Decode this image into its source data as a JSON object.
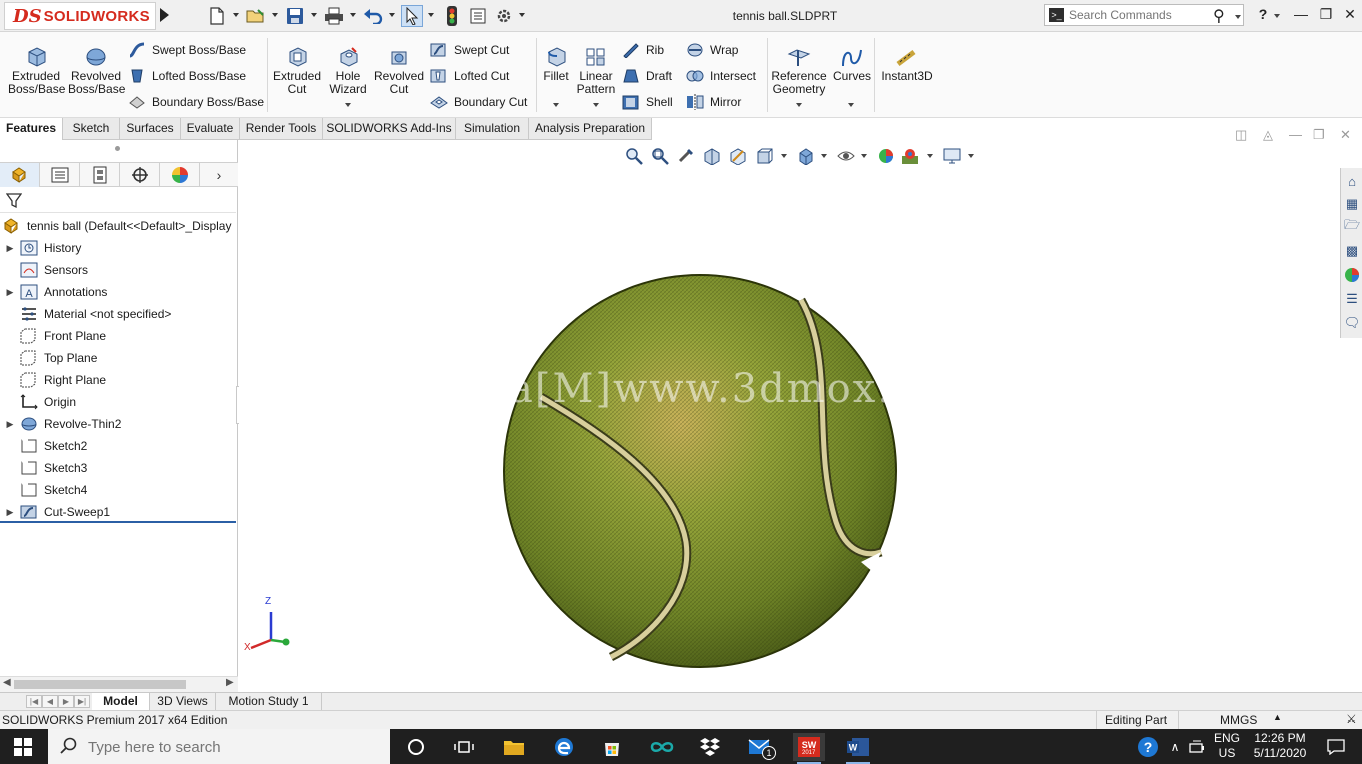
{
  "app": {
    "logo_ds": "DS",
    "logo_text": "SOLIDWORKS",
    "document_title": "tennis ball.SLDPRT",
    "search_placeholder": "Search Commands",
    "help_label": "?"
  },
  "ribbon": {
    "features_large": [
      {
        "label_1": "Extruded",
        "label_2": "Boss/Base"
      },
      {
        "label_1": "Revolved",
        "label_2": "Boss/Base"
      }
    ],
    "features_stack": [
      "Swept Boss/Base",
      "Lofted Boss/Base",
      "Boundary Boss/Base"
    ],
    "cut_large": [
      {
        "label_1": "Extruded",
        "label_2": "Cut"
      },
      {
        "label_1": "Hole",
        "label_2": "Wizard"
      },
      {
        "label_1": "Revolved",
        "label_2": "Cut"
      }
    ],
    "cut_stack": [
      "Swept Cut",
      "Lofted Cut",
      "Boundary Cut"
    ],
    "fillet": "Fillet",
    "linear_pattern_1": "Linear",
    "linear_pattern_2": "Pattern",
    "mid_col_1": [
      "Rib",
      "Draft",
      "Shell"
    ],
    "mid_col_2": [
      "Wrap",
      "Intersect",
      "Mirror"
    ],
    "reference_geometry_1": "Reference",
    "reference_geometry_2": "Geometry",
    "curves": "Curves",
    "instant3d": "Instant3D"
  },
  "command_tabs": [
    "Features",
    "Sketch",
    "Surfaces",
    "Evaluate",
    "Render Tools",
    "SOLIDWORKS Add-Ins",
    "Simulation",
    "Analysis Preparation"
  ],
  "feature_tree": {
    "root": "tennis ball  (Default<<Default>_Display",
    "items": [
      {
        "label": "History",
        "expandable": true
      },
      {
        "label": "Sensors",
        "expandable": false
      },
      {
        "label": "Annotations",
        "expandable": true
      },
      {
        "label": "Material <not specified>",
        "expandable": false
      },
      {
        "label": "Front Plane",
        "expandable": false
      },
      {
        "label": "Top Plane",
        "expandable": false
      },
      {
        "label": "Right Plane",
        "expandable": false
      },
      {
        "label": "Origin",
        "expandable": false
      },
      {
        "label": "Revolve-Thin2",
        "expandable": true
      },
      {
        "label": "Sketch2",
        "expandable": false
      },
      {
        "label": "Sketch3",
        "expandable": false
      },
      {
        "label": "Sketch4",
        "expandable": false
      },
      {
        "label": "Cut-Sweep1",
        "expandable": true
      }
    ]
  },
  "viewport": {
    "watermark": "a[M]www.3dmox.co",
    "triad": {
      "z": "Z",
      "x": "X"
    }
  },
  "bottom_tabs": [
    "Model",
    "3D Views",
    "Motion Study 1"
  ],
  "status_bar": {
    "edition": "SOLIDWORKS Premium 2017 x64 Edition",
    "mode": "Editing Part",
    "units": "MMGS"
  },
  "taskbar": {
    "search_placeholder": "Type here to search",
    "sw_badge": "2017",
    "mail_badge": "1",
    "lang_1": "ENG",
    "lang_2": "US",
    "time": "12:26 PM",
    "date": "5/11/2020"
  },
  "colors": {
    "brand_red": "#d52b1e",
    "selection_blue": "#2b5fa5",
    "ball_green": "#8a9b2a"
  }
}
